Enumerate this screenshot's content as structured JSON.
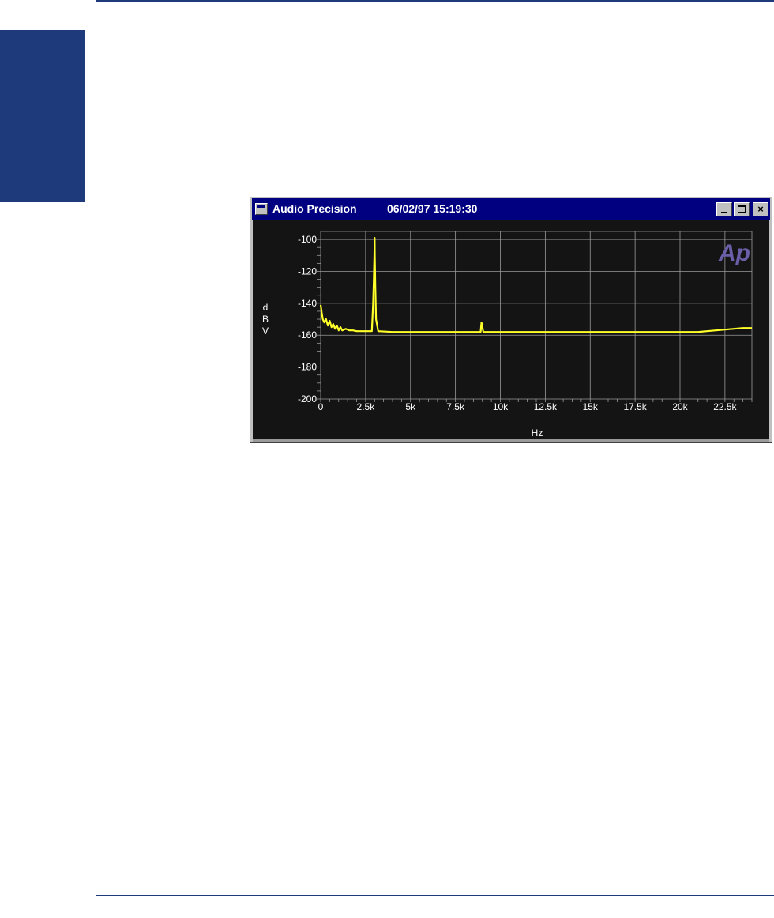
{
  "window": {
    "title": "Audio Precision",
    "timestamp": "06/02/97 15:19:30",
    "buttons": {
      "minimize": "_",
      "maximize": "□",
      "close": "×"
    }
  },
  "logo": {
    "text": "Ap",
    "color": "#6a5fa8"
  },
  "colors": {
    "background": "#141414",
    "grid": "#9a9a9a",
    "trace": "#ffff2a",
    "text": "#ffffff",
    "frame": "#000080"
  },
  "chart_data": {
    "type": "line",
    "title": "",
    "xlabel": "Hz",
    "ylabel": "dBV",
    "ylabel_letters": [
      "d",
      "B",
      "V"
    ],
    "xlim": [
      0,
      24000
    ],
    "ylim": [
      -200,
      -95
    ],
    "grid": true,
    "x_ticks": [
      0,
      2500,
      5000,
      7500,
      10000,
      12500,
      15000,
      17500,
      20000,
      22500
    ],
    "x_tick_labels": [
      "0",
      "2.5k",
      "5k",
      "7.5k",
      "10k",
      "12.5k",
      "15k",
      "17.5k",
      "20k",
      "22.5k"
    ],
    "y_ticks": [
      -100,
      -120,
      -140,
      -160,
      -180,
      -200
    ],
    "y_tick_labels": [
      "-100",
      "-120",
      "-140",
      "-160",
      "-180",
      "-200"
    ],
    "series": [
      {
        "x": [
          0,
          60,
          120,
          200,
          300,
          400,
          500,
          600,
          700,
          800,
          900,
          1000,
          1100,
          1200,
          1400,
          1600,
          1800,
          2000,
          2300,
          2600,
          2850,
          2920,
          2960,
          2990,
          3000,
          3010,
          3040,
          3080,
          3200,
          4000,
          5000,
          6000,
          7000,
          8000,
          8900,
          8950,
          9000,
          9050,
          9100,
          10000,
          11000,
          12000,
          13000,
          14000,
          15000,
          16000,
          17000,
          18000,
          19000,
          20000,
          21000,
          21500,
          22000,
          22500,
          23000,
          23500,
          24000
        ],
        "y": [
          -141,
          -146,
          -150,
          -152,
          -150,
          -154,
          -151,
          -155,
          -153,
          -156,
          -154,
          -157,
          -155,
          -157,
          -156,
          -157,
          -157,
          -157.5,
          -157.5,
          -157.5,
          -157.5,
          -140,
          -125,
          -110,
          -99,
          -110,
          -130,
          -150,
          -157.5,
          -158,
          -158,
          -158,
          -158,
          -158,
          -158,
          -152,
          -155,
          -158,
          -158,
          -158,
          -158,
          -158,
          -158,
          -158,
          -158,
          -158,
          -158,
          -158,
          -158,
          -158,
          -158,
          -157.5,
          -157,
          -156.5,
          -156,
          -155.5,
          -155.5
        ]
      }
    ]
  }
}
